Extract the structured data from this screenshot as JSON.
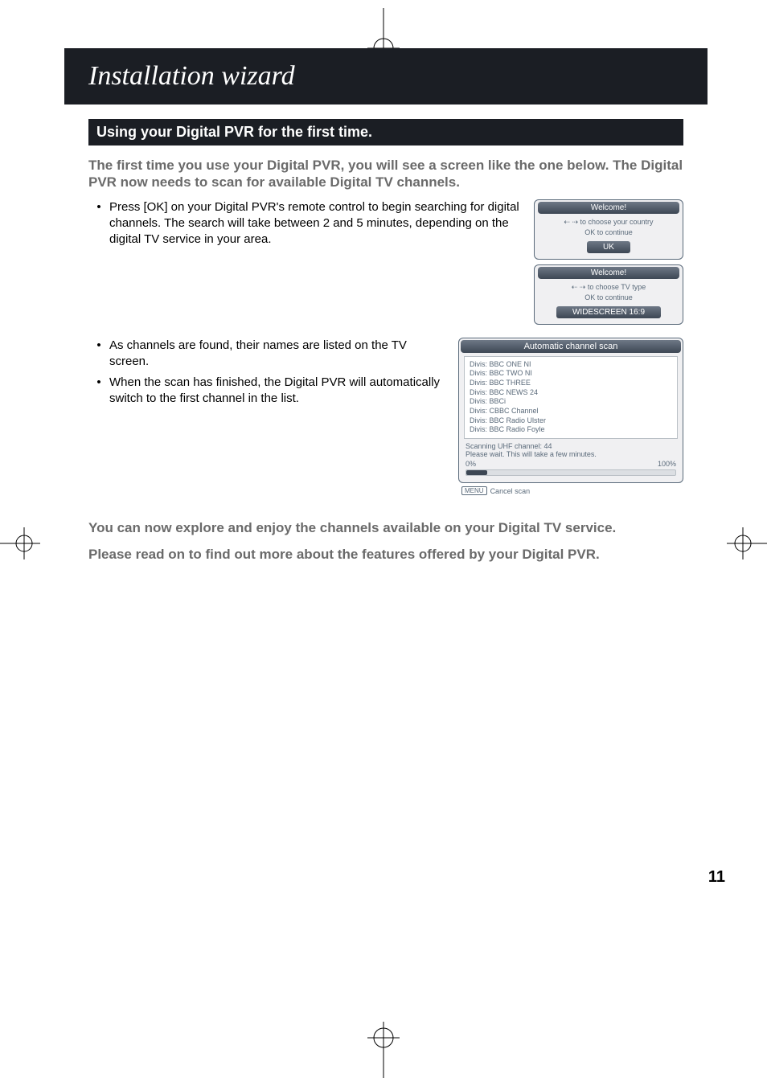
{
  "header": {
    "title": "Installation wizard"
  },
  "sub_bar": "Using your Digital PVR for the first time.",
  "intro": "The first time you use your Digital PVR, you will see a screen like the one below. The Digital PVR now needs to scan for available Digital TV channels.",
  "bullets_a": [
    "Press [OK] on your Digital PVR's remote control to begin searching for digital channels. The search will take between 2 and 5 minutes, depending on the digital TV service in your area."
  ],
  "bullets_b": [
    "As channels are found, their names are listed on the TV screen.",
    "When the scan has finished, the Digital PVR will automatically switch to the first channel in the list."
  ],
  "welcome1": {
    "title": "Welcome!",
    "line1": "⇠ ⇢ to choose your country",
    "line2": "OK to continue",
    "pill": "UK"
  },
  "welcome2": {
    "title": "Welcome!",
    "line1": "⇠ ⇢ to choose TV type",
    "line2": "OK to continue",
    "pill": "WIDESCREEN 16:9"
  },
  "scan": {
    "title": "Automatic channel scan",
    "list": [
      "Divis: BBC ONE NI",
      "Divis: BBC TWO NI",
      "Divis: BBC THREE",
      "Divis: BBC NEWS 24",
      "Divis: BBCi",
      "Divis: CBBC Channel",
      "Divis: BBC Radio Ulster",
      "Divis: BBC Radio Foyle"
    ],
    "status1": "Scanning UHF channel: 44",
    "status2": "Please wait. This will take a few minutes.",
    "pct_left": "0%",
    "pct_right": "100%",
    "footer_key": "MENU",
    "footer_text": "Cancel scan"
  },
  "outro1": "You can now explore and enjoy the channels available on your Digital TV service.",
  "outro2": "Please read on to find out more about the features offered by your Digital PVR.",
  "page_number": "11"
}
